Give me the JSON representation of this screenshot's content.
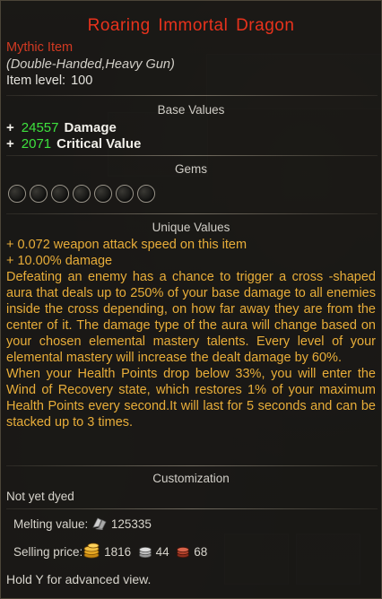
{
  "item": {
    "name": "Roaring Immortal Dragon",
    "rarity": "Mythic Item",
    "type_line": "(Double-Handed,Heavy Gun)",
    "level_label": "Item level:",
    "level_value": "100"
  },
  "sections": {
    "base": "Base Values",
    "gems": "Gems",
    "unique": "Unique Values",
    "custom": "Customization"
  },
  "base_values": [
    {
      "prefix": "+",
      "value": "24557",
      "label": "Damage"
    },
    {
      "prefix": "+",
      "value": "2071",
      "label": "Critical Value"
    }
  ],
  "gem_slots": 7,
  "unique_lines": [
    "+ 0.072 weapon attack speed on this item",
    "+ 10.00% damage"
  ],
  "unique_description": "Defeating an enemy has a chance to trigger a cross -shaped aura that deals up to 250% of your base damage to all enemies inside the cross depending, on how far away they are from the center of it. The damage type of the aura will change based on your chosen elemental mastery talents. Every level of your elemental mastery will increase the dealt damage by 60%.",
  "unique_description_2": "When your Health Points drop below 33%, you will enter the Wind of Recovery state, which restores 1% of your maximum Health Points every second.It will last for 5 seconds and can be stacked up to 3 times.",
  "customization": "Not yet dyed",
  "melting": {
    "label": "Melting value:",
    "value": "125335",
    "icon": "shard-icon"
  },
  "selling": {
    "label": "Selling price:",
    "gold": "1816",
    "silver": "44",
    "copper": "68"
  },
  "hint": "Hold Y for advanced view.",
  "colors": {
    "title": "#e8321c",
    "stat_number": "#3ee23e",
    "unique": "#e8ad39"
  }
}
